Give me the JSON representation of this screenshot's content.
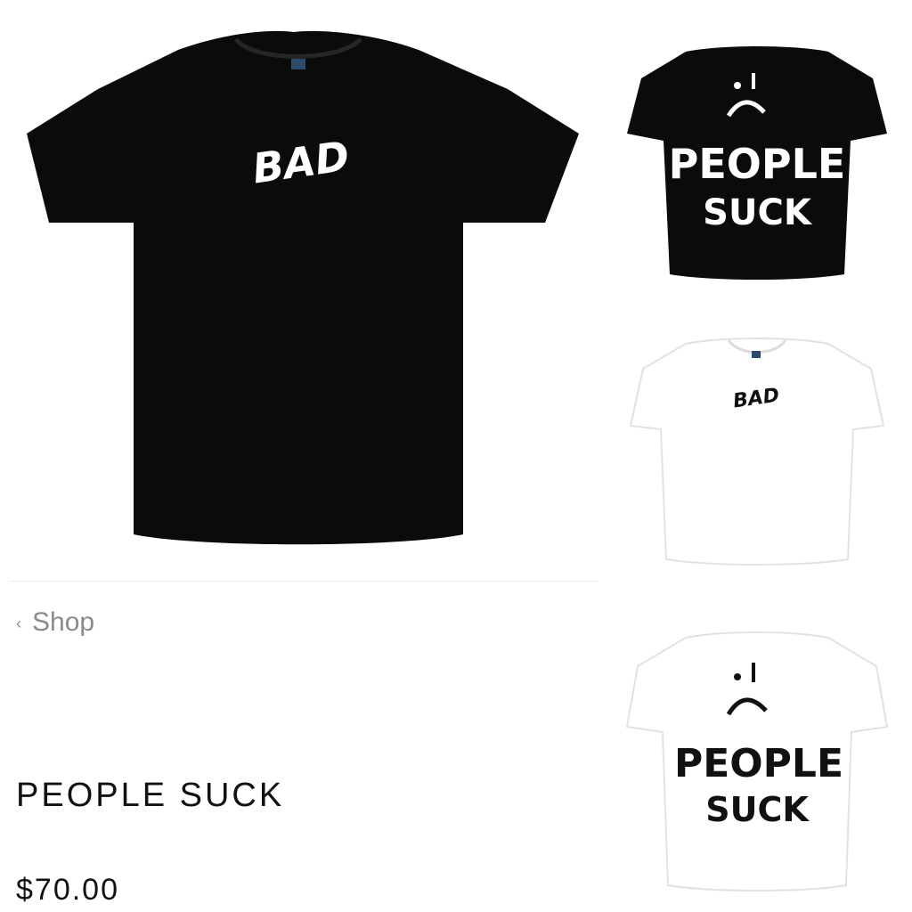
{
  "nav": {
    "back_label": "Shop"
  },
  "product": {
    "title": "PEOPLE SUCK",
    "price": "$70.00"
  },
  "images": {
    "main": {
      "shirt_color": "#0b0b0b",
      "print_color": "#ffffff",
      "print_text": "BAD"
    },
    "thumbs": [
      {
        "shirt_color": "#0b0b0b",
        "print_color": "#ffffff",
        "print_lines": [
          "PEOPLE",
          "SUCK"
        ]
      },
      {
        "shirt_color": "#ffffff",
        "print_color": "#111111",
        "print_text": "BAD"
      },
      {
        "shirt_color": "#ffffff",
        "print_color": "#111111",
        "print_lines": [
          "PEOPLE",
          "SUCK"
        ]
      }
    ]
  }
}
